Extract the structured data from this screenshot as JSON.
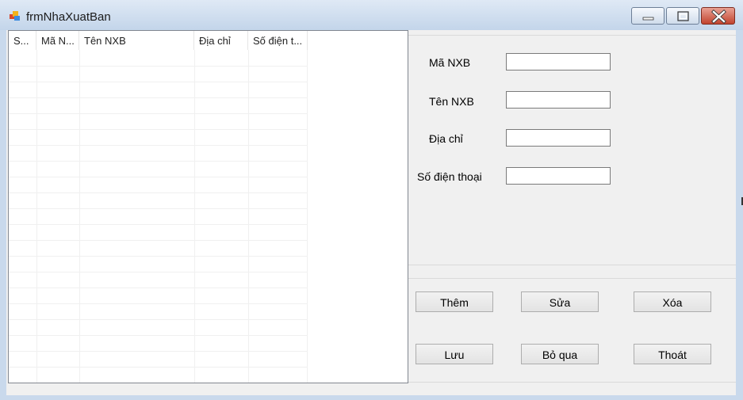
{
  "window": {
    "title": "frmNhaXuatBan",
    "icon": "app-form-icon",
    "controls": [
      "minimize-icon",
      "maximize-icon",
      "close-icon"
    ]
  },
  "grid": {
    "columns": [
      "S...",
      "Mã N...",
      "Tên NXB",
      "Địa chỉ",
      "Số điện t..."
    ],
    "rows": []
  },
  "form": {
    "ma_nxb_label": "Mã NXB",
    "ten_nxb_label": "Tên NXB",
    "dia_chi_label": "Địa chỉ",
    "so_dien_thoai_label": "Số điện thoại",
    "ma_nxb_value": "",
    "ten_nxb_value": "",
    "dia_chi_value": "",
    "so_dien_thoai_value": ""
  },
  "buttons": {
    "them": "Thêm",
    "sua": "Sửa",
    "xoa": "Xóa",
    "luu": "Lưu",
    "bo_qua": "Bỏ qua",
    "thoat": "Thoát"
  },
  "colors": {
    "titlebar": "#c9d9ec",
    "client": "#f0f0f0",
    "close_button": "#c2432e"
  }
}
